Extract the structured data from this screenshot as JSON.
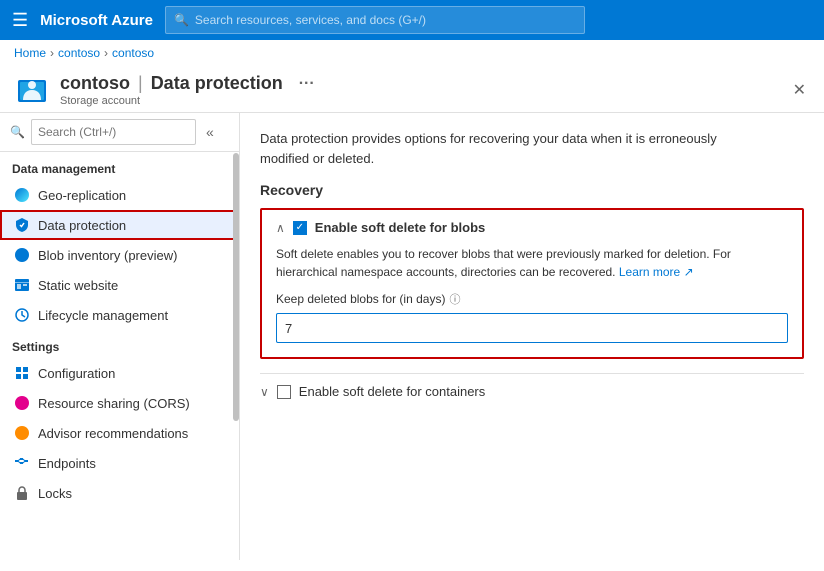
{
  "topnav": {
    "hamburger": "☰",
    "title": "Microsoft Azure",
    "search_placeholder": "Search resources, services, and docs (G+/)"
  },
  "breadcrumb": {
    "items": [
      "Home",
      "contoso",
      "contoso"
    ]
  },
  "page_header": {
    "account_name": "contoso",
    "separator": "|",
    "page_name": "Data protection",
    "subtitle": "Storage account",
    "dots": "···",
    "close": "✕"
  },
  "sidebar": {
    "search_placeholder": "Search (Ctrl+/)",
    "collapse_icon": "«",
    "sections": [
      {
        "title": "Data management",
        "items": [
          {
            "label": "Geo-replication",
            "icon": "geo-icon"
          },
          {
            "label": "Data protection",
            "icon": "data-protection-icon",
            "active": true
          },
          {
            "label": "Blob inventory (preview)",
            "icon": "blob-icon"
          },
          {
            "label": "Static website",
            "icon": "web-icon"
          },
          {
            "label": "Lifecycle management",
            "icon": "lifecycle-icon"
          }
        ]
      },
      {
        "title": "Settings",
        "items": [
          {
            "label": "Configuration",
            "icon": "config-icon"
          },
          {
            "label": "Resource sharing (CORS)",
            "icon": "cors-icon"
          },
          {
            "label": "Advisor recommendations",
            "icon": "advisor-icon"
          },
          {
            "label": "Endpoints",
            "icon": "endpoints-icon"
          },
          {
            "label": "Locks",
            "icon": "locks-icon"
          }
        ]
      }
    ]
  },
  "content": {
    "description": "Data protection provides options for recovering your data when it is erroneously modified or deleted.",
    "recovery_title": "Recovery",
    "soft_delete_blobs": {
      "chevron": "∧",
      "checkbox_checked": true,
      "label": "Enable soft delete for blobs",
      "description": "Soft delete enables you to recover blobs that were previously marked for deletion. For hierarchical namespace accounts, directories can be recovered.",
      "learn_more": "Learn more",
      "keep_label": "Keep deleted blobs for (in days)",
      "days_value": "7"
    },
    "soft_delete_containers": {
      "chevron": "∨",
      "checkbox_checked": false,
      "label": "Enable soft delete for containers"
    }
  }
}
